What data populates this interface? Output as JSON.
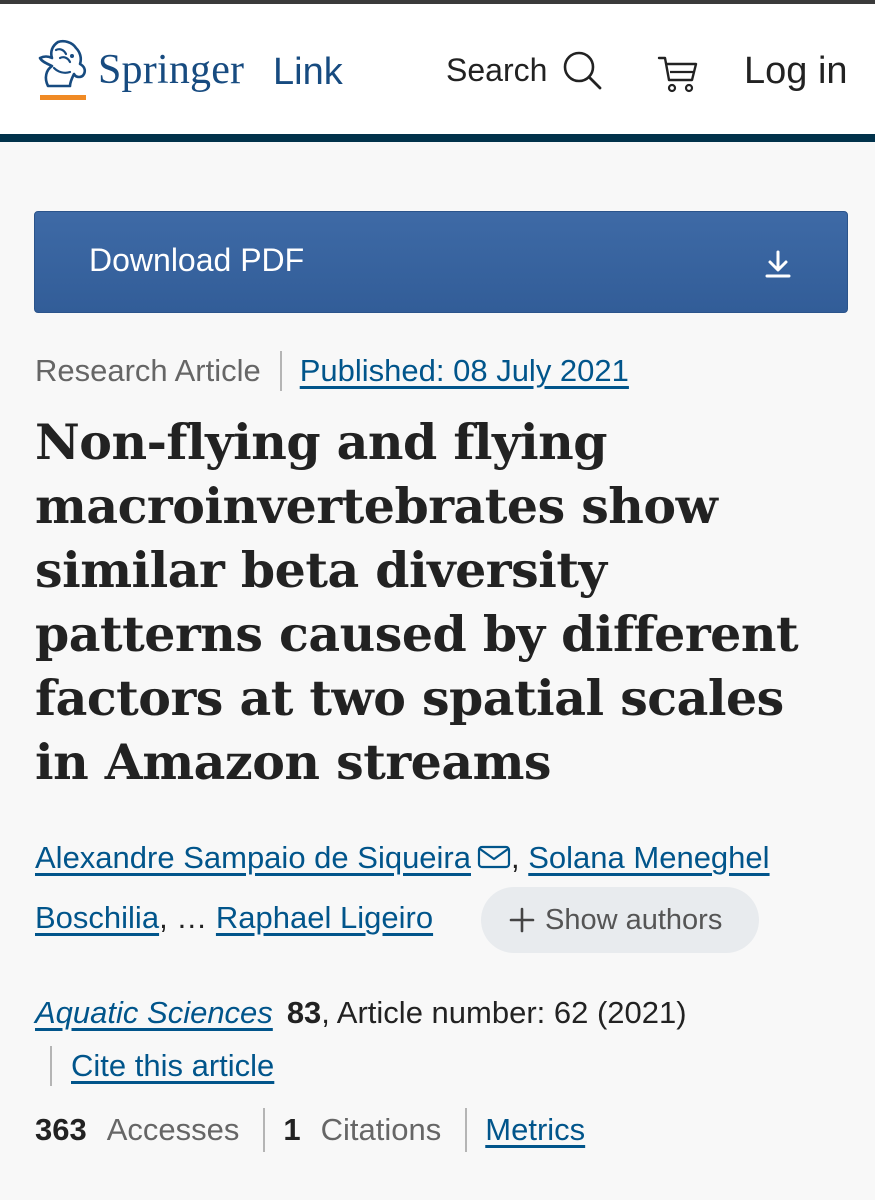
{
  "header": {
    "logo_springer": "Springer",
    "logo_link": "Link",
    "search_label": "Search",
    "login_label": "Log in"
  },
  "download": {
    "label": "Download PDF"
  },
  "article": {
    "type": "Research Article",
    "published": "Published: 08 July 2021",
    "title": "Non-flying and flying macroinvertebrates show similar beta diversity patterns caused by different factors at two spatial scales in Amazon streams"
  },
  "authors": {
    "first": "Alexandre Sampaio de Siqueira",
    "second_part1": "Solana Meneghel",
    "second_part2": "Boschilia",
    "comma1": ",",
    "ellipsis": ", …",
    "last": "Raphael Ligeiro",
    "show_authors": "Show authors"
  },
  "journal": {
    "name": "Aquatic Sciences",
    "volume": "83",
    "article_number": ", Article number: 62 (2021)",
    "cite": "Cite this article"
  },
  "metrics": {
    "accesses_count": "363",
    "accesses_label": "Accesses",
    "citations_count": "1",
    "citations_label": "Citations",
    "metrics_link": "Metrics"
  },
  "colors": {
    "brand_blue": "#174b80",
    "accent_orange": "#f08a24",
    "header_rule": "#01324b",
    "link_blue": "#01558b",
    "button_blue": "#3e6aa6"
  },
  "icons": [
    "springer-horse-logo-icon",
    "search-icon",
    "cart-icon",
    "download-arrow-icon",
    "mail-icon",
    "plus-icon"
  ]
}
